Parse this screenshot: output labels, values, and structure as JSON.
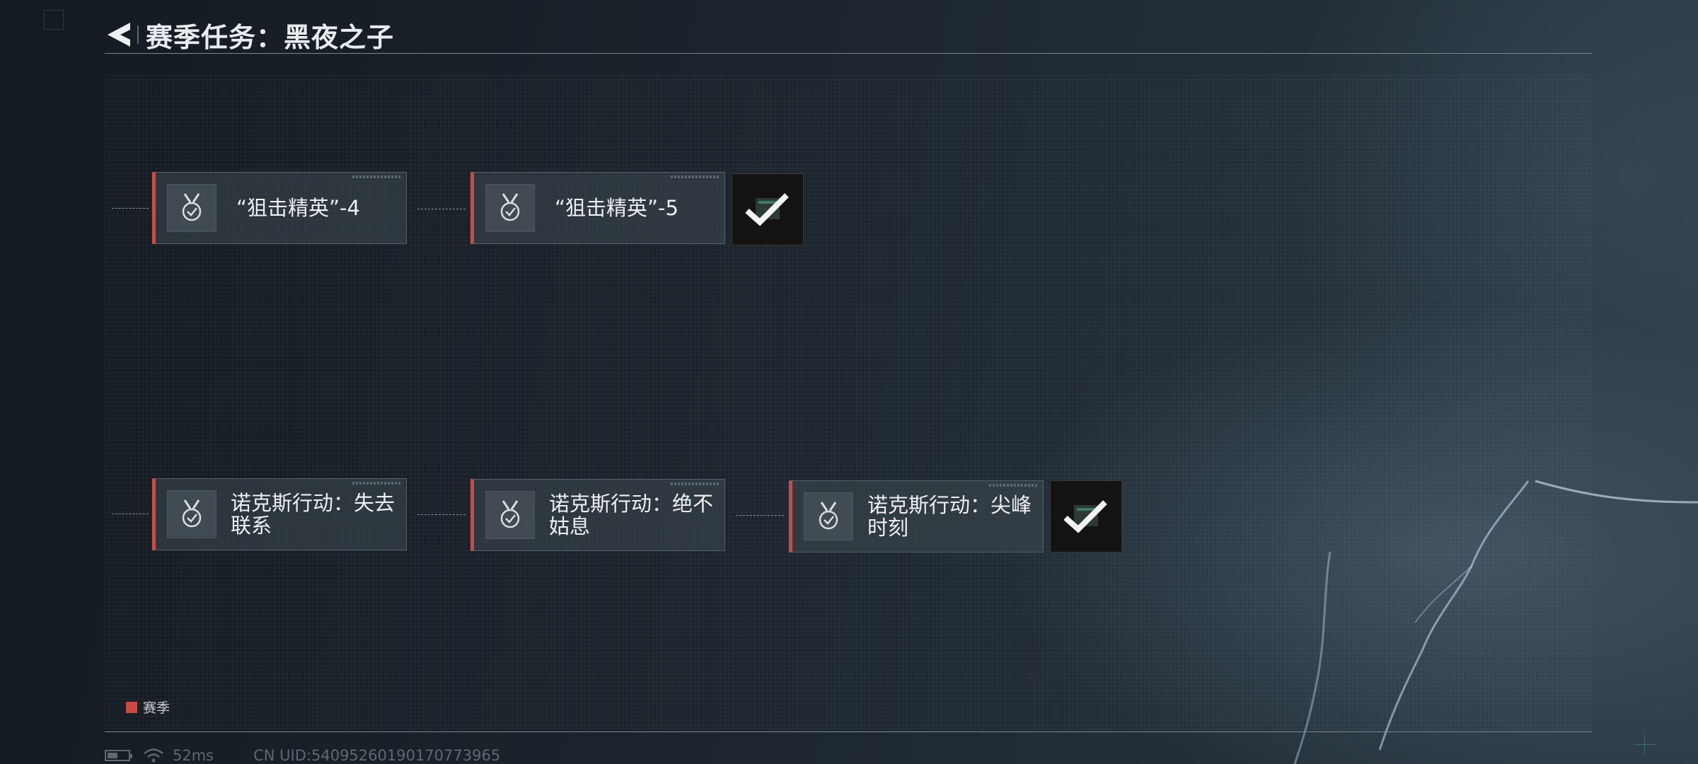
{
  "header": {
    "title": "赛季任务：黑夜之子"
  },
  "tasks": [
    {
      "label": "“狙击精英”-4",
      "icon": "medal-check-icon"
    },
    {
      "label": "“狙击精英”-5",
      "icon": "medal-check-icon"
    },
    {
      "label": "诺克斯行动：失去联系",
      "icon": "medal-check-icon"
    },
    {
      "label": "诺克斯行动：绝不姑息",
      "icon": "medal-check-icon"
    },
    {
      "label": "诺克斯行动：尖峰时刻",
      "icon": "medal-check-icon"
    }
  ],
  "rewards": [
    {
      "icon": "checkmark-icon",
      "state": "claimed"
    },
    {
      "icon": "checkmark-icon",
      "state": "claimed"
    }
  ],
  "legend": {
    "label": "赛季",
    "color": "#c94a45"
  },
  "status": {
    "ping": "52ms",
    "uid": "CN UID:5409526019017077396​5"
  },
  "colors": {
    "accent": "#c94a45",
    "background": "#1b232c"
  }
}
